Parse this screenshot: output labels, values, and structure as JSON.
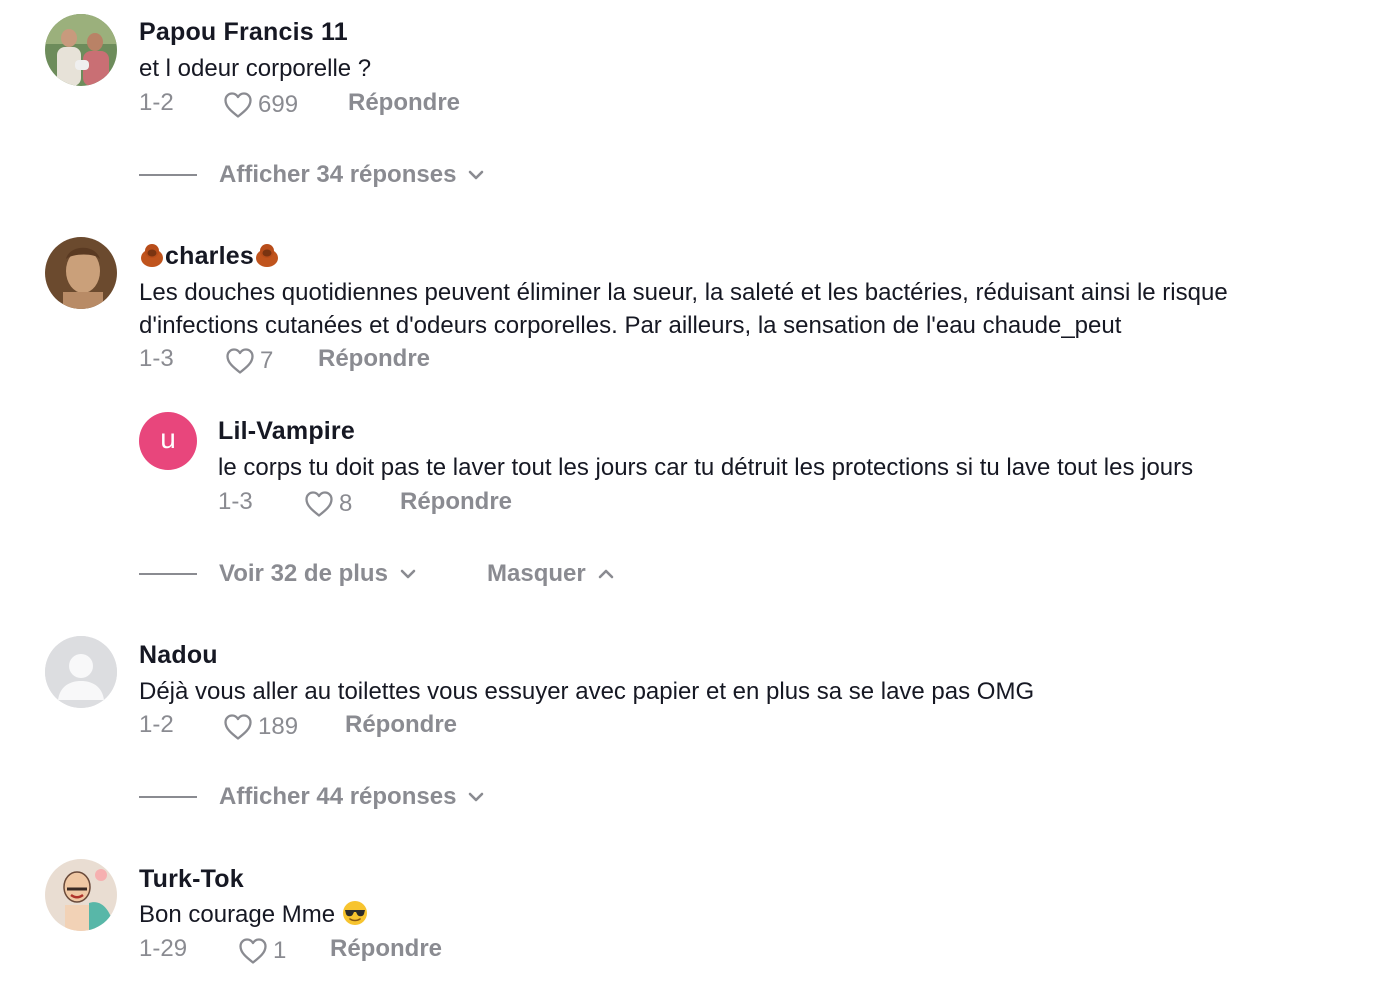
{
  "comments": [
    {
      "username": "Papou Francis 11",
      "text": "et l odeur corporelle ?",
      "date": "1-2",
      "likes": "699",
      "reply_label": "Répondre",
      "expand_label": "Afficher 34 réponses"
    },
    {
      "username": "charles",
      "text_line1": "Les douches quotidiennes peuvent éliminer la sueur, la saleté et les bactéries, réduisant ainsi le risque",
      "text_line2": "d'infections cutanées et d'odeurs corporelles. Par ailleurs, la sensation de l'eau chaude_peut",
      "date": "1-3",
      "likes": "7",
      "reply_label": "Répondre",
      "reply": {
        "avatar_letter": "u",
        "avatar_color": "#e8467c",
        "username": "Lil-Vampire",
        "text": "le corps tu doit pas te laver tout les jours car tu détruit les protections si tu lave tout les jours",
        "date": "1-3",
        "likes": "8",
        "reply_label": "Répondre"
      },
      "more_label": "Voir 32 de plus",
      "hide_label": "Masquer"
    },
    {
      "username": "Nadou",
      "text": "Déjà vous aller au toilettes vous essuyer avec papier et en plus sa se lave pas OMG",
      "date": "1-2",
      "likes": "189",
      "reply_label": "Répondre",
      "expand_label": "Afficher 44 réponses"
    },
    {
      "username": "Turk-Tok",
      "text": "Bon courage Mme",
      "date": "1-29",
      "likes": "1",
      "reply_label": "Répondre"
    }
  ],
  "colors": {
    "text": "#161823",
    "muted": "#8a8b91",
    "reply_avatar": "#e8467c"
  }
}
